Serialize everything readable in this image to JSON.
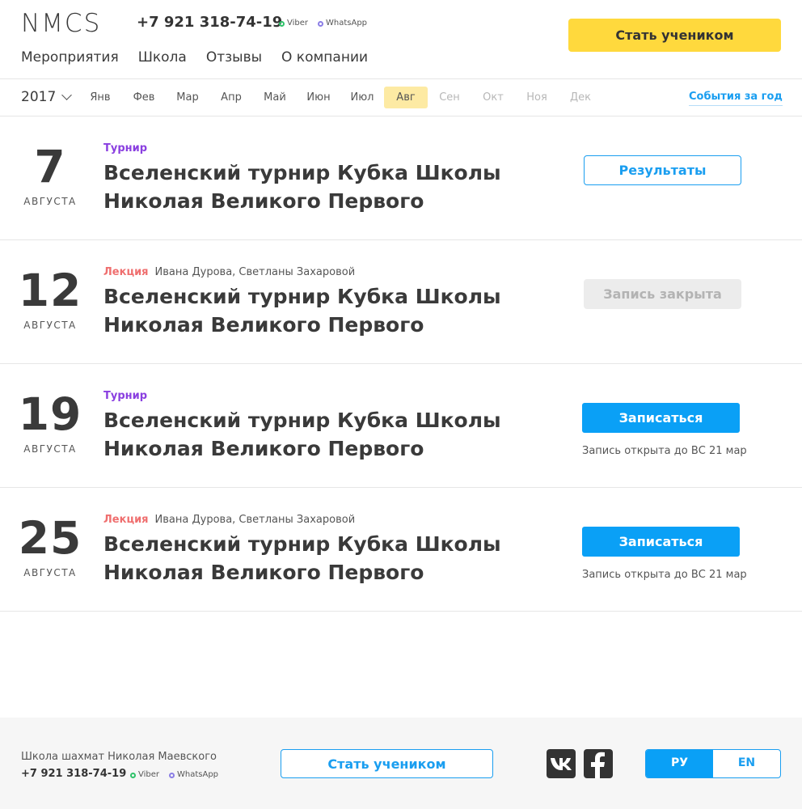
{
  "header": {
    "logo": "NMCS",
    "phone": "+7 921 318-74-19",
    "viber": "Viber",
    "whatsapp": "WhatsApp",
    "cta": "Стать учеником",
    "nav": [
      "Мероприятия",
      "Школа",
      "Отзывы",
      "О компании"
    ]
  },
  "calendar": {
    "year": "2017",
    "months": [
      "Янв",
      "Фев",
      "Мар",
      "Апр",
      "Май",
      "Июн",
      "Июл",
      "Авг",
      "Сен",
      "Окт",
      "Ноя",
      "Дек"
    ],
    "active_month": "Авг",
    "year_events": "События за год"
  },
  "events": [
    {
      "day": "7",
      "month": "АВГУСТА",
      "type": "Турнир",
      "authors": "",
      "title": "Вселенский турнир Кубка Школы Николая Великого Первого",
      "action": "Результаты",
      "note": ""
    },
    {
      "day": "12",
      "month": "АВГУСТА",
      "type": "Лекция",
      "authors": "Ивана Дурова, Светланы Захаровой",
      "title": "Вселенский турнир Кубка Школы Николая Великого Первого",
      "action": "Запись закрыта",
      "note": ""
    },
    {
      "day": "19",
      "month": "АВГУСТА",
      "type": "Турнир",
      "authors": "",
      "title": "Вселенский турнир Кубка Школы Николая Великого Первого",
      "action": "Записаться",
      "note": "Запись открыта до ВС 21 мар"
    },
    {
      "day": "25",
      "month": "АВГУСТА",
      "type": "Лекция",
      "authors": "Ивана Дурова, Светланы Захаровой",
      "title": "Вселенский турнир Кубка Школы Николая Великого Первого",
      "action": "Записаться",
      "note": "Запись открыта до ВС 21 мар"
    }
  ],
  "footer": {
    "school": "Школа шахмат Николая Маевского",
    "phone": "+7 921 318-74-19",
    "viber": "Viber",
    "whatsapp": "WhatsApp",
    "cta": "Стать учеником",
    "social": [
      "vk-icon",
      "facebook-icon"
    ],
    "lang": [
      "РУ",
      "EN"
    ],
    "active_lang": "РУ"
  },
  "colors": {
    "accent_blue": "#0aa0f6",
    "cta_yellow": "#ffd93d",
    "tournament_purple": "#8a3fe0",
    "lecture_red": "#ef6f6f",
    "viber_green": "#2fc26a",
    "whatsapp_violet": "#8b7ee5"
  }
}
